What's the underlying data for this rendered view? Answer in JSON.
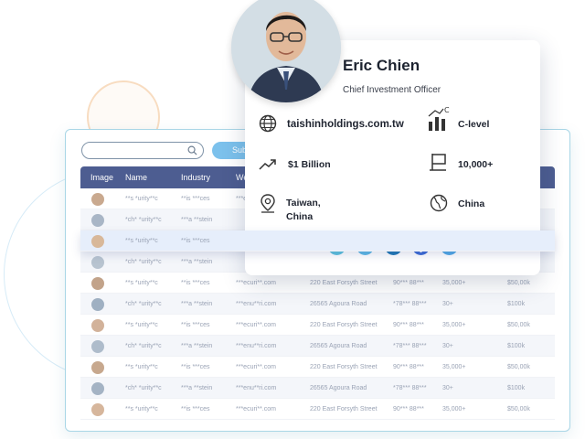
{
  "search": {
    "placeholder": "",
    "button_label": "Submit"
  },
  "table": {
    "columns": [
      "Image",
      "Name",
      "Industry",
      "Website"
    ],
    "rows": [
      {
        "name": "**s *urity**c",
        "industry": "**is ***ces",
        "website": "***ecuri**.com",
        "address": "",
        "phone": "",
        "employees": "",
        "revenue": ""
      },
      {
        "name": "*ch* *urity**c",
        "industry": "***a **stein",
        "website": "",
        "address": "",
        "phone": "",
        "employees": "",
        "revenue": ""
      },
      {
        "name": "**s *urity**c",
        "industry": "**is ***ces",
        "website": "",
        "address": "",
        "phone": "",
        "employees": "",
        "revenue": ""
      },
      {
        "name": "*ch* *urity**c",
        "industry": "***a **stein",
        "website": "",
        "address": "",
        "phone": "",
        "employees": "",
        "revenue": ""
      },
      {
        "name": "**s *urity**c",
        "industry": "**is ***ces",
        "website": "***ecuri**.com",
        "address": "220 East Forsyth Street",
        "phone": "90*** 88***",
        "employees": "35,000+",
        "revenue": "$50,00k"
      },
      {
        "name": "*ch* *urity**c",
        "industry": "***a **stein",
        "website": "***enu**ri.com",
        "address": "26565 Agoura Road",
        "phone": "*78*** 88***",
        "employees": "30+",
        "revenue": "$100k"
      },
      {
        "name": "**s *urity**c",
        "industry": "**is ***ces",
        "website": "***ecuri**.com",
        "address": "220 East Forsyth Street",
        "phone": "90*** 88***",
        "employees": "35,000+",
        "revenue": "$50,00k"
      },
      {
        "name": "*ch* *urity**c",
        "industry": "***a **stein",
        "website": "***enu**ri.com",
        "address": "26565 Agoura Road",
        "phone": "*78*** 88***",
        "employees": "30+",
        "revenue": "$100k"
      },
      {
        "name": "**s *urity**c",
        "industry": "**is ***ces",
        "website": "***ecuri**.com",
        "address": "220 East Forsyth Street",
        "phone": "90*** 88***",
        "employees": "35,000+",
        "revenue": "$50,00k"
      },
      {
        "name": "*ch* *urity**c",
        "industry": "***a **stein",
        "website": "***enu**ri.com",
        "address": "26565 Agoura Road",
        "phone": "*78*** 88***",
        "employees": "30+",
        "revenue": "$100k"
      },
      {
        "name": "**s *urity**c",
        "industry": "**is ***ces",
        "website": "***ecuri**.com",
        "address": "220 East Forsyth Street",
        "phone": "90*** 88***",
        "employees": "35,000+",
        "revenue": "$50,00k"
      }
    ]
  },
  "profile": {
    "name": "Eric Chien",
    "title": "Chief Investment Officer",
    "website": "taishinholdings.com.tw",
    "level": "C-level",
    "level_badge": "C",
    "revenue": "$1 Billion",
    "employees": "10,000+",
    "location_line1": "Taiwan,",
    "location_line2": "China",
    "country": "China"
  },
  "social": [
    {
      "icon": "phone-icon",
      "color": "#5cc2de"
    },
    {
      "icon": "email-icon",
      "color": "#5cb8e6"
    },
    {
      "icon": "linkedin-icon",
      "color": "#1e77b5"
    },
    {
      "icon": "facebook-icon",
      "color": "#3b6bd6"
    },
    {
      "icon": "twitter-icon",
      "color": "#4fa8e6"
    }
  ],
  "colors": {
    "header_bg": "#4d5d91",
    "panel_border": "#a9d6e6",
    "accent": "#7cc1ec"
  }
}
